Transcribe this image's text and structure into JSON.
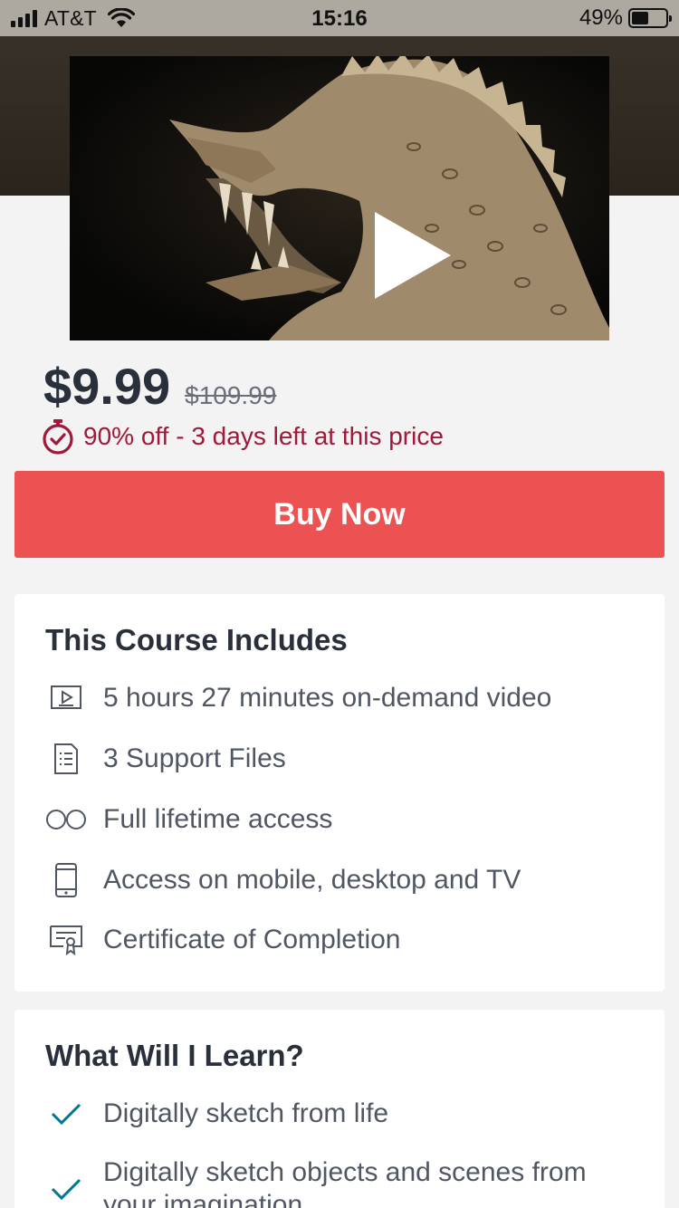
{
  "status_bar": {
    "carrier": "AT&T",
    "time": "15:16",
    "battery": "49%"
  },
  "video": {
    "thumbnail": "dragon-sketch",
    "play_icon": "play-icon"
  },
  "pricing": {
    "price": "$9.99",
    "original_price": "$109.99",
    "discount_text": "90% off - 3 days left at this price",
    "discount_color": "#a1183a"
  },
  "buy_button": {
    "label": "Buy Now",
    "color": "#ec5252"
  },
  "includes": {
    "title": "This Course Includes",
    "items": [
      {
        "icon": "video-icon",
        "text": "5 hours 27 minutes on-demand video"
      },
      {
        "icon": "file-icon",
        "text": "3 Support Files"
      },
      {
        "icon": "infinity-icon",
        "text": "Full lifetime access"
      },
      {
        "icon": "mobile-icon",
        "text": "Access on mobile, desktop and TV"
      },
      {
        "icon": "certificate-icon",
        "text": "Certificate of Completion"
      }
    ]
  },
  "learn": {
    "title": "What Will I Learn?",
    "items": [
      {
        "icon": "check-icon",
        "text": "Digitally sketch from life"
      },
      {
        "icon": "check-icon",
        "text": "Digitally sketch objects and scenes from your imagination"
      }
    ],
    "check_color": "#007791"
  }
}
